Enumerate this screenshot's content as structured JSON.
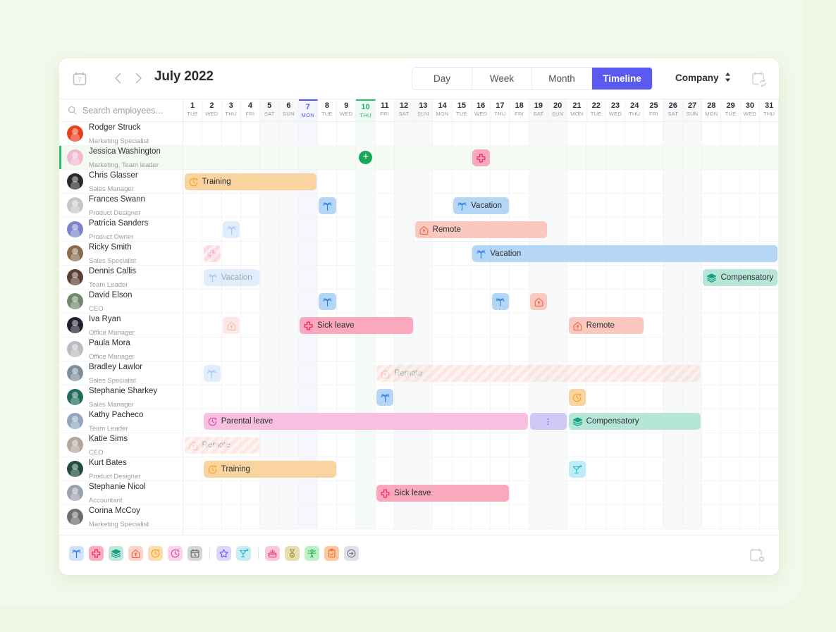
{
  "header": {
    "calendar_icon_day": "7",
    "title": "July 2022",
    "prev_label": "‹",
    "next_label": "›",
    "views": [
      {
        "label": "Day",
        "active": false
      },
      {
        "label": "Week",
        "active": false
      },
      {
        "label": "Month",
        "active": false
      },
      {
        "label": "Timeline",
        "active": true
      }
    ],
    "scope_label": "Company",
    "accent_color": "#5a5af0"
  },
  "search": {
    "placeholder": "Search employees..."
  },
  "days": [
    {
      "num": "1",
      "wk": "TUE",
      "type": "normal"
    },
    {
      "num": "2",
      "wk": "WED",
      "type": "normal"
    },
    {
      "num": "3",
      "wk": "THU",
      "type": "normal"
    },
    {
      "num": "4",
      "wk": "FRI",
      "type": "normal"
    },
    {
      "num": "5",
      "wk": "SAT",
      "type": "weekend"
    },
    {
      "num": "6",
      "wk": "SUN",
      "type": "weekend"
    },
    {
      "num": "7",
      "wk": "MON",
      "type": "current"
    },
    {
      "num": "8",
      "wk": "TUE",
      "type": "normal"
    },
    {
      "num": "9",
      "wk": "WED",
      "type": "normal"
    },
    {
      "num": "10",
      "wk": "THU",
      "type": "today"
    },
    {
      "num": "11",
      "wk": "FRI",
      "type": "normal"
    },
    {
      "num": "12",
      "wk": "SAT",
      "type": "weekend"
    },
    {
      "num": "13",
      "wk": "SUN",
      "type": "weekend"
    },
    {
      "num": "14",
      "wk": "MON",
      "type": "normal"
    },
    {
      "num": "15",
      "wk": "TUE",
      "type": "normal"
    },
    {
      "num": "16",
      "wk": "WED",
      "type": "normal"
    },
    {
      "num": "17",
      "wk": "THU",
      "type": "normal"
    },
    {
      "num": "18",
      "wk": "FRI",
      "type": "normal"
    },
    {
      "num": "19",
      "wk": "SAT",
      "type": "weekend"
    },
    {
      "num": "20",
      "wk": "SUN",
      "type": "weekend"
    },
    {
      "num": "21",
      "wk": "MON",
      "type": "normal"
    },
    {
      "num": "22",
      "wk": "TUE",
      "type": "normal"
    },
    {
      "num": "23",
      "wk": "WED",
      "type": "normal"
    },
    {
      "num": "24",
      "wk": "THU",
      "type": "normal"
    },
    {
      "num": "25",
      "wk": "FRI",
      "type": "normal"
    },
    {
      "num": "26",
      "wk": "SAT",
      "type": "weekend"
    },
    {
      "num": "27",
      "wk": "SUN",
      "type": "weekend"
    },
    {
      "num": "28",
      "wk": "MON",
      "type": "normal"
    },
    {
      "num": "29",
      "wk": "TUE",
      "type": "normal"
    },
    {
      "num": "30",
      "wk": "WED",
      "type": "normal"
    },
    {
      "num": "31",
      "wk": "THU",
      "type": "normal"
    }
  ],
  "employees": [
    {
      "name": "Rodger Struck",
      "role": "Marketing Specialist",
      "avatar": "#e8401a",
      "selected": false
    },
    {
      "name": "Jessica Washington",
      "role": "Marketing, Team leader",
      "avatar": "#f2b8cf",
      "selected": true
    },
    {
      "name": "Chris Glasser",
      "role": "Sales Manager",
      "avatar": "#2b2b2b",
      "selected": false
    },
    {
      "name": "Frances Swann",
      "role": "Product Designer",
      "avatar": "#c3c6c9",
      "selected": false
    },
    {
      "name": "Patricia Sanders",
      "role": "Product Owner",
      "avatar": "#7b84c8",
      "selected": false
    },
    {
      "name": "Ricky Smith",
      "role": "Sales Specialist",
      "avatar": "#8a6a4a",
      "selected": false
    },
    {
      "name": "Dennis Callis",
      "role": "Team Leader",
      "avatar": "#5a3f33",
      "selected": false
    },
    {
      "name": "David Elson",
      "role": "CEO",
      "avatar": "#6f8a6a",
      "selected": false
    },
    {
      "name": "Iva Ryan",
      "role": "Office Manager",
      "avatar": "#231f2e",
      "selected": false
    },
    {
      "name": "Paula Mora",
      "role": "Office Manager",
      "avatar": "#b9bcc0",
      "selected": false
    },
    {
      "name": "Bradley Lawlor",
      "role": "Sales Specialist",
      "avatar": "#7d8e9a",
      "selected": false
    },
    {
      "name": "Stephanie Sharkey",
      "role": "Sales Manager",
      "avatar": "#1f6b5c",
      "selected": false
    },
    {
      "name": "Kathy Pacheco",
      "role": "Team Leader",
      "avatar": "#8fa6bd",
      "selected": false
    },
    {
      "name": "Katie Sims",
      "role": "CEO",
      "avatar": "#b0a79c",
      "selected": false
    },
    {
      "name": "Kurt Bates",
      "role": "Product Designer",
      "avatar": "#1f4d3f",
      "selected": false
    },
    {
      "name": "Stephanie Nicol",
      "role": "Accountant",
      "avatar": "#9aa3ab",
      "selected": false
    },
    {
      "name": "Corina McCoy",
      "role": "Marketing Specialist",
      "avatar": "#6e6e6e",
      "selected": false
    }
  ],
  "event_types": {
    "vacation": {
      "label": "Vacation",
      "icon": "palm-tree-icon",
      "bg": "#b6d6f8",
      "fg": "#2b2f33",
      "icon_color": "#2f7fe0"
    },
    "sick": {
      "label": "Sick leave",
      "icon": "medical-cross-icon",
      "bg": "#f9a8bd",
      "fg": "#2b2f33",
      "icon_color": "#f01f5a"
    },
    "remote": {
      "label": "Remote",
      "icon": "home-icon",
      "bg": "#fac8bf",
      "fg": "#2b2f33",
      "icon_color": "#ef6b52"
    },
    "training": {
      "label": "Training",
      "icon": "clock-icon",
      "bg": "#fad4a0",
      "fg": "#2b2f33",
      "icon_color": "#f5a623"
    },
    "parental": {
      "label": "Parental leave",
      "icon": "clock-icon",
      "bg": "#f9bfe0",
      "fg": "#2b2f33",
      "icon_color": "#d94fae"
    },
    "compensatory": {
      "label": "Compensatory",
      "icon": "layers-icon",
      "bg": "#b6e6d8",
      "fg": "#2b2f33",
      "icon_color": "#17a184"
    },
    "cocktail": {
      "label": "",
      "icon": "cocktail-icon",
      "bg": "#bdeef5",
      "fg": "#2b2f33",
      "icon_color": "#2bb8d6"
    },
    "pending": {
      "label": "",
      "icon": "dots-icon",
      "bg": "#cfc9f7",
      "fg": "#5a5af0",
      "icon_color": "#5a5af0"
    }
  },
  "events": [
    {
      "row": 1,
      "start": 16,
      "span": 1,
      "type": "sick",
      "text": "",
      "faded": false,
      "striped": false,
      "selected": true
    },
    {
      "row": 2,
      "start": 1,
      "span": 7,
      "type": "training",
      "text": "Training",
      "faded": false,
      "striped": false,
      "selected": false
    },
    {
      "row": 3,
      "start": 8,
      "span": 1,
      "type": "vacation",
      "text": "",
      "faded": false,
      "striped": false,
      "selected": false
    },
    {
      "row": 3,
      "start": 15,
      "span": 3,
      "type": "vacation",
      "text": "Vacation",
      "faded": false,
      "striped": false,
      "selected": false
    },
    {
      "row": 4,
      "start": 3,
      "span": 1,
      "type": "vacation",
      "text": "",
      "faded": true,
      "striped": false,
      "selected": false
    },
    {
      "row": 4,
      "start": 13,
      "span": 7,
      "type": "remote",
      "text": "Remote",
      "faded": false,
      "striped": false,
      "selected": false
    },
    {
      "row": 5,
      "start": 2,
      "span": 1,
      "type": "sick",
      "text": "",
      "faded": true,
      "striped": true,
      "selected": false
    },
    {
      "row": 5,
      "start": 16,
      "span": 16,
      "type": "vacation",
      "text": "Vacation",
      "faded": false,
      "striped": false,
      "selected": false
    },
    {
      "row": 6,
      "start": 2,
      "span": 3,
      "type": "vacation",
      "text": "Vacation",
      "faded": true,
      "striped": false,
      "selected": false
    },
    {
      "row": 6,
      "start": 28,
      "span": 4,
      "type": "compensatory",
      "text": "Compensatory",
      "faded": false,
      "striped": false,
      "selected": false
    },
    {
      "row": 7,
      "start": 8,
      "span": 1,
      "type": "vacation",
      "text": "",
      "faded": false,
      "striped": false,
      "selected": false
    },
    {
      "row": 7,
      "start": 17,
      "span": 1,
      "type": "vacation",
      "text": "",
      "faded": false,
      "striped": false,
      "selected": false
    },
    {
      "row": 7,
      "start": 19,
      "span": 1,
      "type": "remote",
      "text": "",
      "faded": false,
      "striped": false,
      "selected": false
    },
    {
      "row": 8,
      "start": 3,
      "span": 1,
      "type": "remote",
      "text": "",
      "faded": true,
      "striped": false,
      "selected": false
    },
    {
      "row": 8,
      "start": 7,
      "span": 6,
      "type": "sick",
      "text": "Sick leave",
      "faded": false,
      "striped": false,
      "selected": false
    },
    {
      "row": 8,
      "start": 21,
      "span": 4,
      "type": "remote",
      "text": "Remote",
      "faded": false,
      "striped": false,
      "selected": false
    },
    {
      "row": 10,
      "start": 2,
      "span": 1,
      "type": "vacation",
      "text": "",
      "faded": true,
      "striped": false,
      "selected": false
    },
    {
      "row": 10,
      "start": 11,
      "span": 17,
      "type": "remote",
      "text": "Remote",
      "faded": true,
      "striped": true,
      "selected": false
    },
    {
      "row": 11,
      "start": 11,
      "span": 1,
      "type": "vacation",
      "text": "",
      "faded": false,
      "striped": false,
      "selected": false
    },
    {
      "row": 11,
      "start": 21,
      "span": 1,
      "type": "training",
      "text": "",
      "faded": false,
      "striped": false,
      "selected": false
    },
    {
      "row": 12,
      "start": 2,
      "span": 17,
      "type": "parental",
      "text": "Parental leave",
      "faded": false,
      "striped": false,
      "selected": false
    },
    {
      "row": 12,
      "start": 19,
      "span": 2,
      "type": "pending",
      "text": "",
      "faded": false,
      "striped": false,
      "selected": false
    },
    {
      "row": 12,
      "start": 21,
      "span": 7,
      "type": "compensatory",
      "text": "Compensatory",
      "faded": false,
      "striped": false,
      "selected": false
    },
    {
      "row": 13,
      "start": 1,
      "span": 4,
      "type": "remote",
      "text": "Remote",
      "faded": true,
      "striped": true,
      "selected": false
    },
    {
      "row": 14,
      "start": 2,
      "span": 7,
      "type": "training",
      "text": "Training",
      "faded": false,
      "striped": false,
      "selected": false
    },
    {
      "row": 14,
      "start": 21,
      "span": 1,
      "type": "cocktail",
      "text": "",
      "faded": false,
      "striped": false,
      "selected": false
    },
    {
      "row": 15,
      "start": 11,
      "span": 7,
      "type": "sick",
      "text": "Sick leave",
      "faded": false,
      "striped": false,
      "selected": false
    }
  ],
  "add_button": {
    "row": 1,
    "day": 10,
    "label": "+",
    "color": "#17a757"
  },
  "legend": {
    "group1": [
      {
        "name": "palm-tree-icon",
        "bg": "#cfe4fb",
        "color": "#2f7fe0"
      },
      {
        "name": "medical-cross-icon",
        "bg": "#fbaec1",
        "color": "#f01f5a"
      },
      {
        "name": "layers-icon",
        "bg": "#bfe8da",
        "color": "#17a184"
      },
      {
        "name": "home-icon",
        "bg": "#fcd4cb",
        "color": "#ef6b52"
      },
      {
        "name": "clock-icon",
        "bg": "#fcddb0",
        "color": "#f5a623"
      },
      {
        "name": "clock-pink-icon",
        "bg": "#fbd3ea",
        "color": "#d94fae"
      },
      {
        "name": "calendar-clock-icon",
        "bg": "#d5d7d9",
        "color": "#6c7075"
      }
    ],
    "group2": [
      {
        "name": "star-icon",
        "bg": "#ddd6fb",
        "color": "#7a5cf0"
      },
      {
        "name": "cocktail-icon",
        "bg": "#c8eef4",
        "color": "#2bb8d6"
      }
    ],
    "group3": [
      {
        "name": "birthday-cake-icon",
        "bg": "#fbc9dd",
        "color": "#e8457f"
      },
      {
        "name": "medal-icon",
        "bg": "#e5dfae",
        "color": "#a59a4a"
      },
      {
        "name": "onboarding-icon",
        "bg": "#bdf0c9",
        "color": "#27b04b"
      },
      {
        "name": "clipboard-check-icon",
        "bg": "#fcc9a6",
        "color": "#f2752a"
      },
      {
        "name": "sign-out-icon",
        "bg": "#dfe1e8",
        "color": "#7a7f88"
      }
    ]
  }
}
